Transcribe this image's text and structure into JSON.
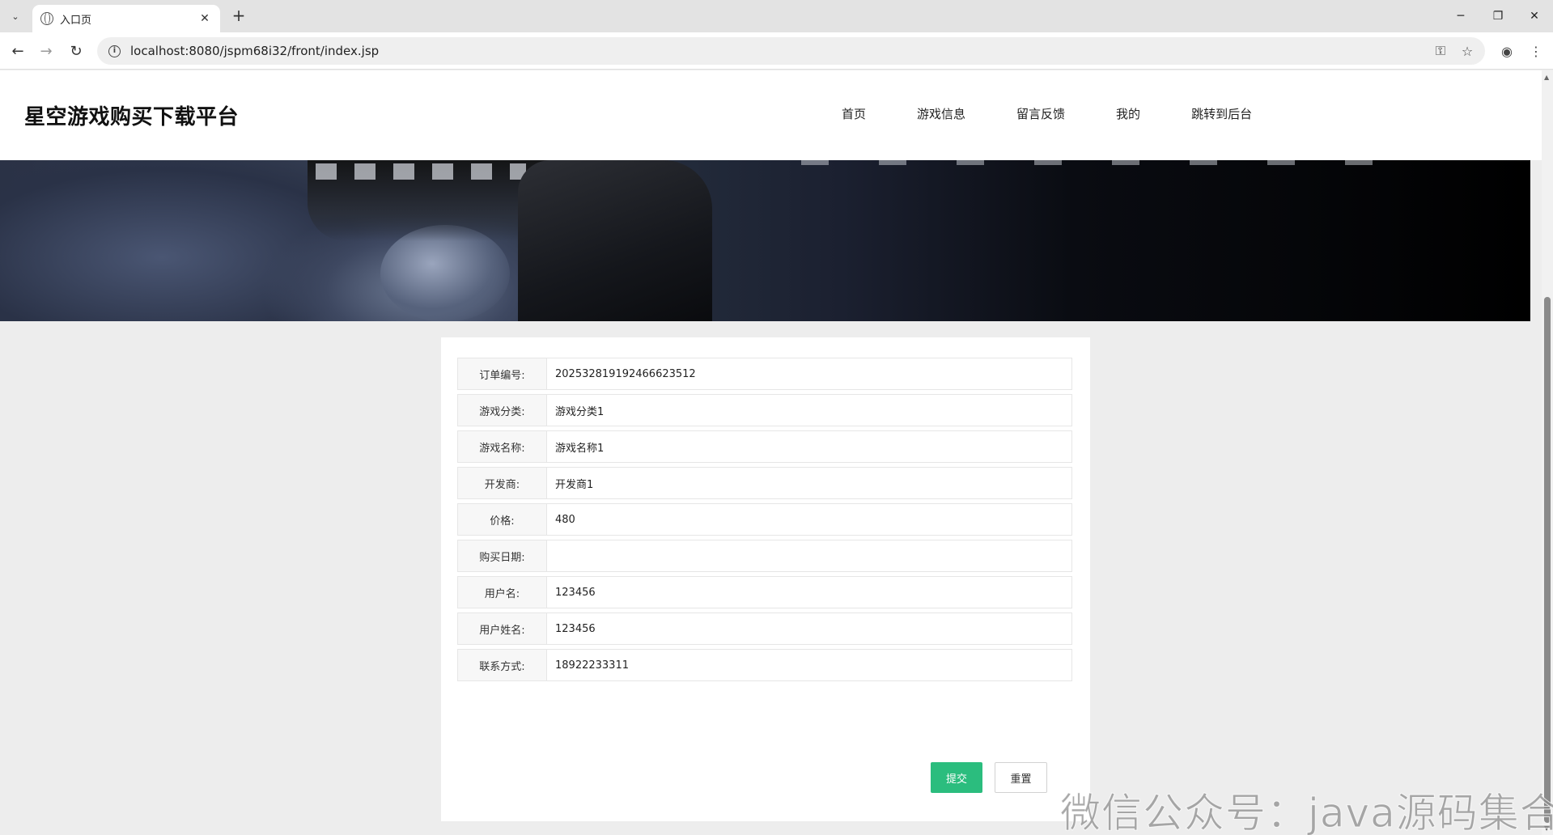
{
  "browser": {
    "tab_title": "入口页",
    "tab_close": "✕",
    "new_tab": "+",
    "url": "localhost:8080/jspm68i32/front/index.jsp",
    "window_controls": {
      "minimize": "─",
      "restore": "❐",
      "close": "✕"
    },
    "icons": [
      "back-icon",
      "forward-icon",
      "reload-icon",
      "info-icon",
      "password-key-icon",
      "bookmark-star-icon",
      "profile-icon",
      "menu-icon"
    ]
  },
  "site": {
    "title": "星空游戏购买下载平台",
    "nav": [
      {
        "label": "首页"
      },
      {
        "label": "游戏信息"
      },
      {
        "label": "留言反馈"
      },
      {
        "label": "我的"
      },
      {
        "label": "跳转到后台"
      }
    ]
  },
  "form": {
    "fields": [
      {
        "label": "订单编号:",
        "value": "2025328191924666235​12"
      },
      {
        "label": "游戏分类:",
        "value": "游戏分类1"
      },
      {
        "label": "游戏名称:",
        "value": "游戏名称1"
      },
      {
        "label": "开发商:",
        "value": "开发商1"
      },
      {
        "label": "价格:",
        "value": "480"
      },
      {
        "label": "购买日期:",
        "value": ""
      },
      {
        "label": "用户名:",
        "value": "123456"
      },
      {
        "label": "用户姓名:",
        "value": "123456"
      },
      {
        "label": "联系方式:",
        "value": "18922233311"
      }
    ],
    "submit_label": "提交",
    "reset_label": "重置",
    "submit_color": "#2bbd7e"
  },
  "watermark": "微信公众号：java源码集合"
}
